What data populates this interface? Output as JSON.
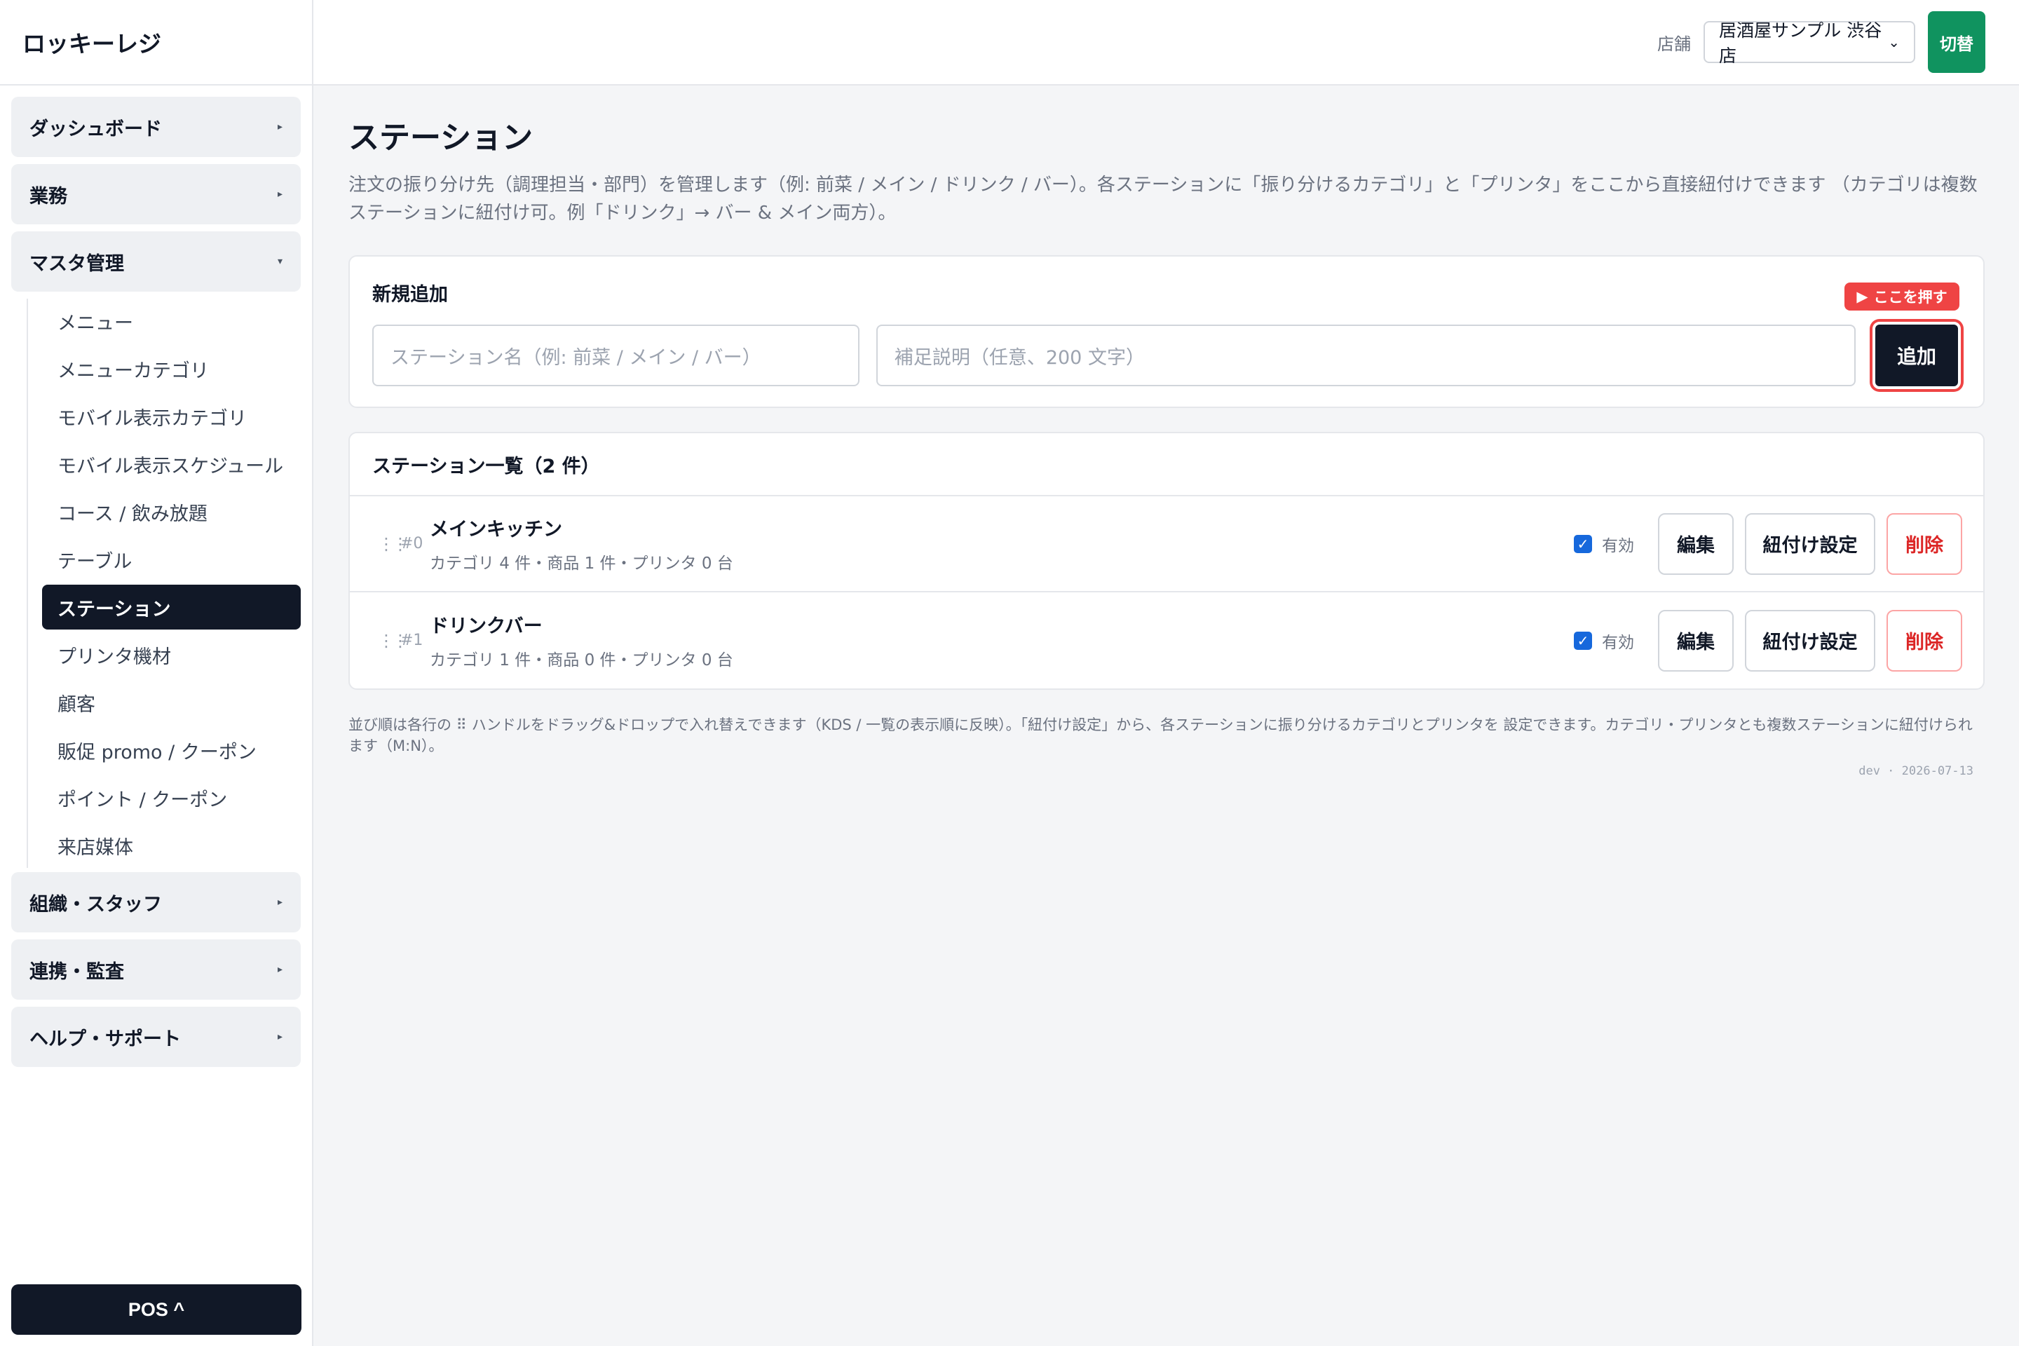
{
  "app": {
    "brand": "ロッキーレジ"
  },
  "sidebar": {
    "groups_top": [
      {
        "label": "ダッシュボード",
        "caret": "▸"
      },
      {
        "label": "業務",
        "caret": "▸"
      }
    ],
    "master": {
      "label": "マスタ管理",
      "caret": "▾"
    },
    "master_items": [
      "メニュー",
      "メニューカテゴリ",
      "モバイル表示カテゴリ",
      "モバイル表示スケジュール",
      "コース / 飲み放題",
      "テーブル",
      "ステーション",
      "プリンタ機材",
      "顧客",
      "販促 promo / クーポン",
      "ポイント / クーポン",
      "来店媒体"
    ],
    "active_item": "ステーション",
    "groups_bottom": [
      {
        "label": "組織・スタッフ",
        "caret": "▸"
      },
      {
        "label": "連携・監査",
        "caret": "▸"
      },
      {
        "label": "ヘルプ・サポート",
        "caret": "▸"
      }
    ],
    "pos_button": "POS ^"
  },
  "topbar": {
    "store_label": "店舗",
    "store_selected": "居酒屋サンプル 渋谷店",
    "switch_label": "切替"
  },
  "page": {
    "title": "ステーション",
    "description": "注文の振り分け先（調理担当・部門）を管理します（例: 前菜 / メイン / ドリンク / バー）。各ステーションに「振り分けるカテゴリ」と「プリンタ」をここから直接紐付けできます （カテゴリは複数ステーションに紐付け可。例「ドリンク」→ バー & メイン両方）。"
  },
  "add_form": {
    "title": "新規追加",
    "name_placeholder": "ステーション名（例: 前菜 / メイン / バー）",
    "desc_placeholder": "補足説明（任意、200 文字）",
    "add_label": "追加",
    "hint_label": "ここを押す"
  },
  "station_list": {
    "title": "ステーション一覧（2 件）",
    "enabled_label": "有効",
    "edit_label": "編集",
    "link_label": "紐付け設定",
    "delete_label": "削除",
    "rows": [
      {
        "index": "#0",
        "name": "メインキッチン",
        "meta": "カテゴリ 4 件・商品 1 件・プリンタ 0 台",
        "enabled": true
      },
      {
        "index": "#1",
        "name": "ドリンクバー",
        "meta": "カテゴリ 1 件・商品 0 件・プリンタ 0 台",
        "enabled": true
      }
    ]
  },
  "footer": {
    "note": "並び順は各行の ⠿ ハンドルをドラッグ&ドロップで入れ替えできます（KDS / 一覧の表示順に反映）。「紐付け設定」から、各ステーションに振り分けるカテゴリとプリンタを 設定できます。カテゴリ・プリンタとも複数ステーションに紐付けられます（M:N）。",
    "build": "dev · 2026-07-13"
  }
}
